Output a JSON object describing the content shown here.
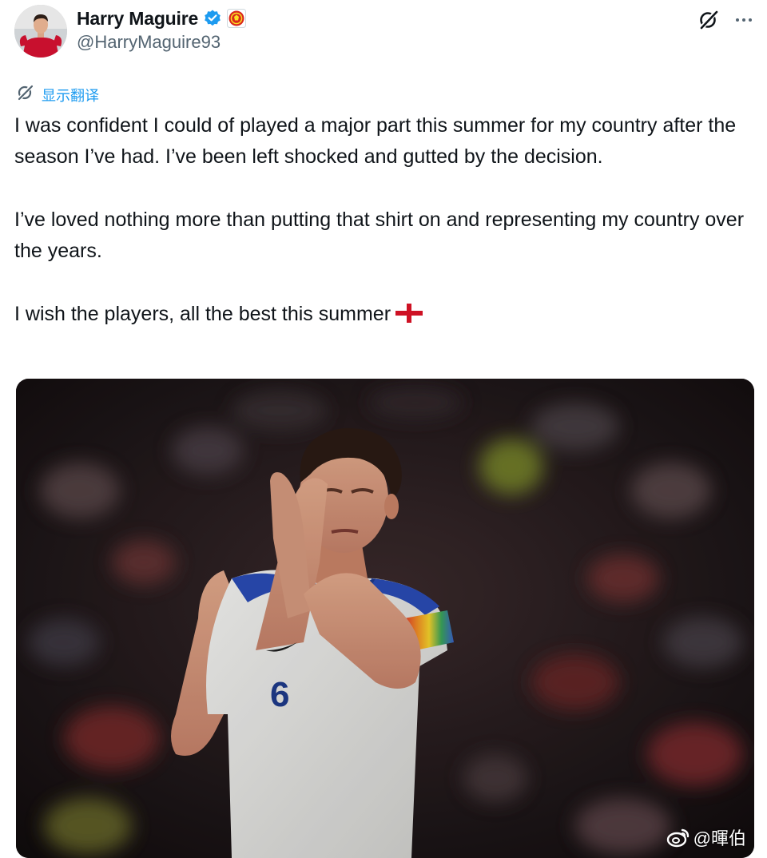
{
  "author": {
    "display_name": "Harry Maguire",
    "handle": "@HarryMaguire93",
    "verified_icon": "verified-badge-icon",
    "affiliate_icon": "manchester-united-crest-icon"
  },
  "actions": {
    "grok_icon": "grok-icon",
    "more_icon": "more-options-icon"
  },
  "translate": {
    "label": "显示翻译"
  },
  "tweet": {
    "paragraphs": [
      "I was confident I could of played a major part this summer for my country after the season I’ve had. I’ve been left shocked and gutted by the decision.",
      "I’ve loved nothing more than putting that shirt on and representing my country over the years.",
      "I wish the players, all the best this summer"
    ],
    "flag_emoji": "england-flag-icon"
  },
  "media": {
    "shirt_number": "6"
  },
  "watermark": {
    "text": "@暉伯",
    "icon": "weibo-icon"
  },
  "colors": {
    "link": "#1d9bf0",
    "text": "#0f1419",
    "secondary": "#536471",
    "verified": "#1d9bf0"
  }
}
